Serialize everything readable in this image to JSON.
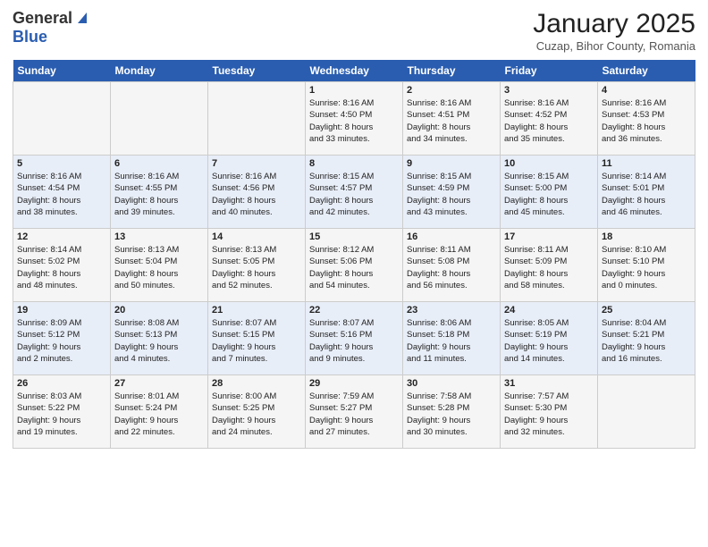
{
  "header": {
    "logo_general": "General",
    "logo_blue": "Blue",
    "month_title": "January 2025",
    "location": "Cuzap, Bihor County, Romania"
  },
  "days_of_week": [
    "Sunday",
    "Monday",
    "Tuesday",
    "Wednesday",
    "Thursday",
    "Friday",
    "Saturday"
  ],
  "weeks": [
    [
      {
        "day": "",
        "info": ""
      },
      {
        "day": "",
        "info": ""
      },
      {
        "day": "",
        "info": ""
      },
      {
        "day": "1",
        "info": "Sunrise: 8:16 AM\nSunset: 4:50 PM\nDaylight: 8 hours\nand 33 minutes."
      },
      {
        "day": "2",
        "info": "Sunrise: 8:16 AM\nSunset: 4:51 PM\nDaylight: 8 hours\nand 34 minutes."
      },
      {
        "day": "3",
        "info": "Sunrise: 8:16 AM\nSunset: 4:52 PM\nDaylight: 8 hours\nand 35 minutes."
      },
      {
        "day": "4",
        "info": "Sunrise: 8:16 AM\nSunset: 4:53 PM\nDaylight: 8 hours\nand 36 minutes."
      }
    ],
    [
      {
        "day": "5",
        "info": "Sunrise: 8:16 AM\nSunset: 4:54 PM\nDaylight: 8 hours\nand 38 minutes."
      },
      {
        "day": "6",
        "info": "Sunrise: 8:16 AM\nSunset: 4:55 PM\nDaylight: 8 hours\nand 39 minutes."
      },
      {
        "day": "7",
        "info": "Sunrise: 8:16 AM\nSunset: 4:56 PM\nDaylight: 8 hours\nand 40 minutes."
      },
      {
        "day": "8",
        "info": "Sunrise: 8:15 AM\nSunset: 4:57 PM\nDaylight: 8 hours\nand 42 minutes."
      },
      {
        "day": "9",
        "info": "Sunrise: 8:15 AM\nSunset: 4:59 PM\nDaylight: 8 hours\nand 43 minutes."
      },
      {
        "day": "10",
        "info": "Sunrise: 8:15 AM\nSunset: 5:00 PM\nDaylight: 8 hours\nand 45 minutes."
      },
      {
        "day": "11",
        "info": "Sunrise: 8:14 AM\nSunset: 5:01 PM\nDaylight: 8 hours\nand 46 minutes."
      }
    ],
    [
      {
        "day": "12",
        "info": "Sunrise: 8:14 AM\nSunset: 5:02 PM\nDaylight: 8 hours\nand 48 minutes."
      },
      {
        "day": "13",
        "info": "Sunrise: 8:13 AM\nSunset: 5:04 PM\nDaylight: 8 hours\nand 50 minutes."
      },
      {
        "day": "14",
        "info": "Sunrise: 8:13 AM\nSunset: 5:05 PM\nDaylight: 8 hours\nand 52 minutes."
      },
      {
        "day": "15",
        "info": "Sunrise: 8:12 AM\nSunset: 5:06 PM\nDaylight: 8 hours\nand 54 minutes."
      },
      {
        "day": "16",
        "info": "Sunrise: 8:11 AM\nSunset: 5:08 PM\nDaylight: 8 hours\nand 56 minutes."
      },
      {
        "day": "17",
        "info": "Sunrise: 8:11 AM\nSunset: 5:09 PM\nDaylight: 8 hours\nand 58 minutes."
      },
      {
        "day": "18",
        "info": "Sunrise: 8:10 AM\nSunset: 5:10 PM\nDaylight: 9 hours\nand 0 minutes."
      }
    ],
    [
      {
        "day": "19",
        "info": "Sunrise: 8:09 AM\nSunset: 5:12 PM\nDaylight: 9 hours\nand 2 minutes."
      },
      {
        "day": "20",
        "info": "Sunrise: 8:08 AM\nSunset: 5:13 PM\nDaylight: 9 hours\nand 4 minutes."
      },
      {
        "day": "21",
        "info": "Sunrise: 8:07 AM\nSunset: 5:15 PM\nDaylight: 9 hours\nand 7 minutes."
      },
      {
        "day": "22",
        "info": "Sunrise: 8:07 AM\nSunset: 5:16 PM\nDaylight: 9 hours\nand 9 minutes."
      },
      {
        "day": "23",
        "info": "Sunrise: 8:06 AM\nSunset: 5:18 PM\nDaylight: 9 hours\nand 11 minutes."
      },
      {
        "day": "24",
        "info": "Sunrise: 8:05 AM\nSunset: 5:19 PM\nDaylight: 9 hours\nand 14 minutes."
      },
      {
        "day": "25",
        "info": "Sunrise: 8:04 AM\nSunset: 5:21 PM\nDaylight: 9 hours\nand 16 minutes."
      }
    ],
    [
      {
        "day": "26",
        "info": "Sunrise: 8:03 AM\nSunset: 5:22 PM\nDaylight: 9 hours\nand 19 minutes."
      },
      {
        "day": "27",
        "info": "Sunrise: 8:01 AM\nSunset: 5:24 PM\nDaylight: 9 hours\nand 22 minutes."
      },
      {
        "day": "28",
        "info": "Sunrise: 8:00 AM\nSunset: 5:25 PM\nDaylight: 9 hours\nand 24 minutes."
      },
      {
        "day": "29",
        "info": "Sunrise: 7:59 AM\nSunset: 5:27 PM\nDaylight: 9 hours\nand 27 minutes."
      },
      {
        "day": "30",
        "info": "Sunrise: 7:58 AM\nSunset: 5:28 PM\nDaylight: 9 hours\nand 30 minutes."
      },
      {
        "day": "31",
        "info": "Sunrise: 7:57 AM\nSunset: 5:30 PM\nDaylight: 9 hours\nand 32 minutes."
      },
      {
        "day": "",
        "info": ""
      }
    ]
  ]
}
